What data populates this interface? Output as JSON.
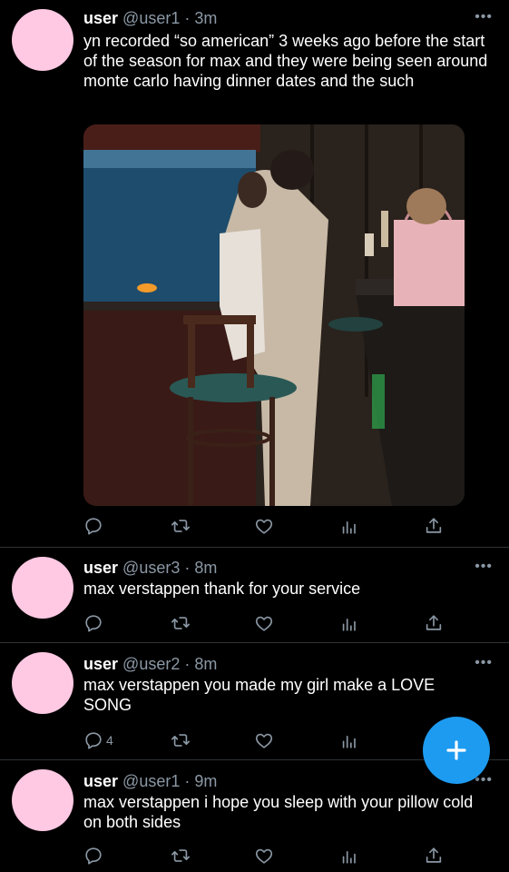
{
  "tweets": [
    {
      "name": "user",
      "handle": "@user1",
      "sep": " · ",
      "time": "3m",
      "text": "yn recorded “so american” 3 weeks ago before the start of the season for max and they were being seen around monte carlo having dinner dates and the such",
      "reply_count": ""
    },
    {
      "name": "user",
      "handle": "@user3",
      "sep": " · ",
      "time": "8m",
      "text": "max verstappen thank for your service",
      "reply_count": ""
    },
    {
      "name": "user",
      "handle": "@user2",
      "sep": " · ",
      "time": "8m",
      "text": "max verstappen you made my girl make a LOVE SONG",
      "reply_count": "4"
    },
    {
      "name": "user",
      "handle": "@user1",
      "sep": " · ",
      "time": "9m",
      "text": "max verstappen i hope you sleep with your pillow cold on both sides",
      "reply_count": ""
    }
  ],
  "colors": {
    "background": "#000000",
    "avatar": "#ffc9e3",
    "muted": "#8b98a5",
    "accent": "#1d9bf0"
  },
  "icons": [
    "more-icon",
    "reply-icon",
    "retweet-icon",
    "like-icon",
    "analytics-icon",
    "share-icon",
    "compose-plus-icon"
  ]
}
